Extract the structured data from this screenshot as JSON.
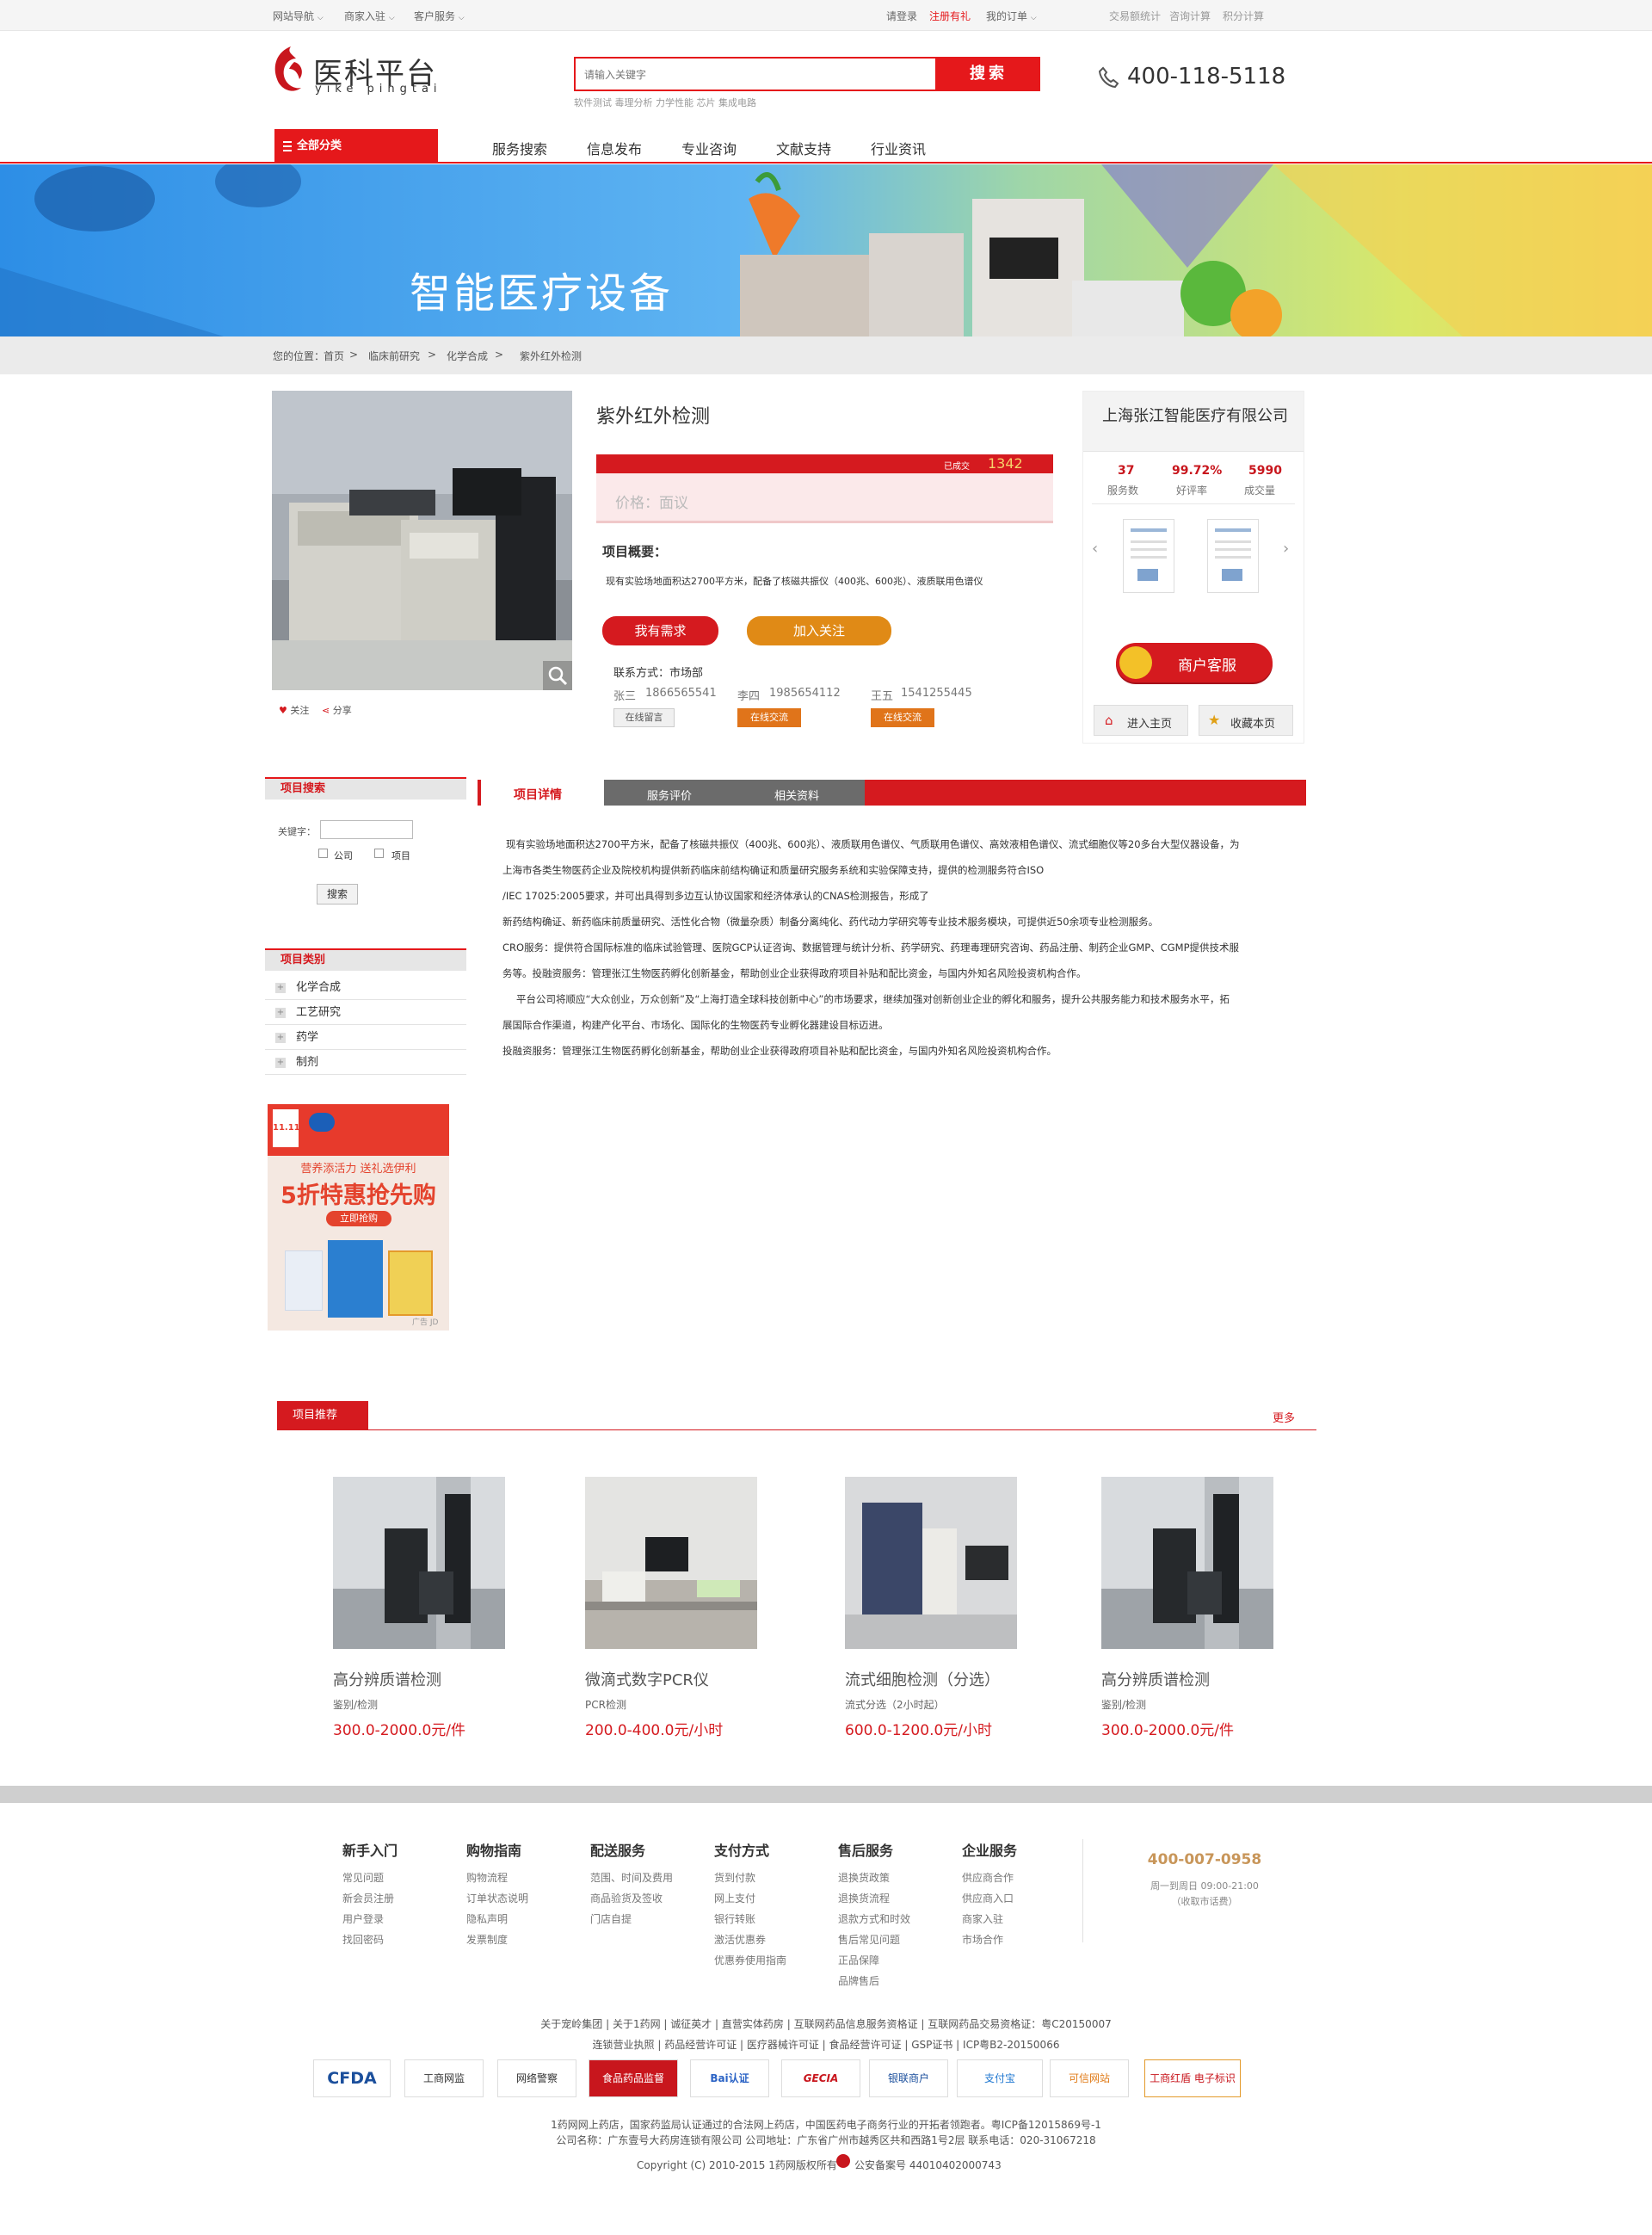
{
  "topbar": {
    "site_nav": "网站导航",
    "merchant_join": "商家入驻",
    "customer_service": "客户服务",
    "login": "请登录",
    "register": "注册有礼",
    "my_orders": "我的订单",
    "trade_stats": "交易额统计",
    "consult_count": "咨询计算",
    "points_count": "积分计算"
  },
  "header": {
    "logo_title": "医科平台",
    "logo_sub": "yike pingtai",
    "search_placeholder": "请输入关键字",
    "search_button": "搜索",
    "hot_words": "软件测试 毒理分析 力学性能 芯片 集成电路",
    "phone": "400-118-5118"
  },
  "nav": {
    "all_categories": "全部分类",
    "items": [
      "服务搜索",
      "信息发布",
      "专业咨询",
      "文献支持",
      "行业资讯"
    ]
  },
  "banner": {
    "title": "智能医疗设备"
  },
  "breadcrumb": {
    "prefix": "您的位置：",
    "items": [
      "首页",
      "临床前研究",
      "化学合成",
      "紫外红外检测"
    ],
    "sep": ">"
  },
  "product": {
    "title": "紫外红外检测",
    "sold_label": "已成交",
    "sold_count": "1342",
    "price_label": "价格：面议",
    "overview_label": "项目概要：",
    "overview_text": "现有实验场地面积达2700平方米，配备了核磁共振仪（400兆、600兆）、液质联用色谱仪",
    "btn_demand": "我有需求",
    "btn_follow": "加入关注",
    "contact_label": "联系方式：市场部",
    "contacts": [
      {
        "name": "张三",
        "phone": "1866565541",
        "button": "在线留言"
      },
      {
        "name": "李四",
        "phone": "1985654112",
        "button": "在线交流"
      },
      {
        "name": "王五",
        "phone": "1541255445",
        "button": "在线交流"
      }
    ],
    "follow_text": "关注",
    "share_text": "分享"
  },
  "company": {
    "name": "上海张江智能医疗有限公司",
    "stats": [
      {
        "value": "37",
        "label": "服务数"
      },
      {
        "value": "99.72%",
        "label": "好评率"
      },
      {
        "value": "5990",
        "label": "成交量"
      }
    ],
    "service_btn": "商户客服",
    "home_btn": "进入主页",
    "fav_btn": "收藏本页"
  },
  "sidebar": {
    "search_title": "项目搜索",
    "keyword_label": "关键字：",
    "opt_company": "公司",
    "opt_project": "项目",
    "search_btn": "搜索",
    "category_title": "项目类别",
    "categories": [
      "化学合成",
      "工艺研究",
      "药学",
      "制剂"
    ]
  },
  "ad": {
    "badge": "11.11",
    "line1": "营养添活力 送礼选伊利",
    "line2": "5折特惠抢先购",
    "btn": "立即抢购",
    "tag": "广告 JD"
  },
  "tabs": {
    "items": [
      "项目详情",
      "服务评价",
      "相关资料"
    ]
  },
  "detail": {
    "lines": [
      "现有实验场地面积达2700平方米，配备了核磁共振仪（400兆、600兆）、液质联用色谱仪、气质联用色谱仪、高效液相色谱仪、流式细胞仪等20多台大型仪器设备，为",
      "上海市各类生物医药企业及院校机构提供新药临床前结构确证和质量研究服务系统和实验保障支持，提供的检测服务符合ISO",
      "/IEC 17025:2005要求，并可出具得到多边互认协议国家和经济体承认的CNAS检测报告，形成了",
      "新药结构确证、新药临床前质量研究、活性化合物（微量杂质）制备分离纯化、药代动力学研究等专业技术服务模块，可提供近50余项专业检测服务。",
      "CRO服务：提供符合国际标准的临床试验管理、医院GCP认证咨询、数据管理与统计分析、药学研究、药理毒理研究咨询、药品注册、制药企业GMP、CGMP提供技术服",
      "务等。投融资服务：管理张江生物医药孵化创新基金，帮助创业企业获得政府项目补贴和配比资金，与国内外知名风险投资机构合作。",
      "平台公司将顺应“大众创业，万众创新”及“上海打造全球科技创新中心”的市场要求，继续加强对创新创业企业的孵化和服务，提升公共服务能力和技术服务水平，拓",
      "展国际合作渠道，构建产化平台、市场化、国际化的生物医药专业孵化器建设目标迈进。",
      "投融资服务：管理张江生物医药孵化创新基金，帮助创业企业获得政府项目补贴和配比资金，与国内外知名风险投资机构合作。"
    ]
  },
  "recommend": {
    "title": "项目推荐",
    "more": "更多",
    "items": [
      {
        "name": "高分辨质谱检测",
        "sub": "鉴别/检测",
        "price": "300.0-2000.0元/件"
      },
      {
        "name": "微滴式数字PCR仪",
        "sub": "PCR检测",
        "price": "200.0-400.0元/小时"
      },
      {
        "name": "流式细胞检测（分选）",
        "sub": "流式分选（2小时起）",
        "price": "600.0-1200.0元/小时"
      },
      {
        "name": "高分辨质谱检测",
        "sub": "鉴别/检测",
        "price": "300.0-2000.0元/件"
      }
    ]
  },
  "footer": {
    "columns": [
      {
        "title": "新手入门",
        "items": [
          "常见问题",
          "新会员注册",
          "用户登录",
          "找回密码"
        ]
      },
      {
        "title": "购物指南",
        "items": [
          "购物流程",
          "订单状态说明",
          "隐私声明",
          "发票制度"
        ]
      },
      {
        "title": "配送服务",
        "items": [
          "范围、时间及费用",
          "商品验货及签收",
          "门店自提"
        ]
      },
      {
        "title": "支付方式",
        "items": [
          "货到付款",
          "网上支付",
          "银行转账",
          "激活优惠券",
          "优惠券使用指南"
        ]
      },
      {
        "title": "售后服务",
        "items": [
          "退换货政策",
          "退换货流程",
          "退款方式和时效",
          "售后常见问题",
          "正品保障",
          "品牌售后"
        ]
      },
      {
        "title": "企业服务",
        "items": [
          "供应商合作",
          "供应商入口",
          "商家入驻",
          "市场合作"
        ]
      }
    ],
    "hotline": "400-007-0958",
    "hours": "周一到周日 09:00-21:00",
    "hours_note": "（收取市话费）",
    "links1": "关于宠岭集团 | 关于1药网 | 诚征英才 | 直营实体药房 | 互联网药品信息服务资格证 | 互联网药品交易资格证：粤C20150007",
    "links1_highlight": "诚征英才",
    "links2": "连锁营业执照 | 药品经营许可证 | 医疗器械许可证 | 食品经营许可证 | GSP证书 | ICP粤B2-20150066",
    "certs": [
      "CFDA",
      "工商网监",
      "网络警察",
      "食品药品监督",
      "Bai认证",
      "GECIA",
      "银联商户",
      "支付宝",
      "可信网站",
      "工商红盾 电子标识"
    ],
    "line1": "1药网网上药店，国家药监局认证通过的合法网上药店，中国医药电子商务行业的开拓者领跑者。粤ICP备12015869号-1",
    "line2": "公司名称：广东壹号大药房连锁有限公司 公司地址：广东省广州市越秀区共和西路1号2层 联系电话：020-31067218",
    "line3": "Copyright (C) 2010-2015 1药网版权所有",
    "beian": "公安备案号 44010402000743"
  },
  "colors": {
    "brand_red": "#e5181b",
    "accent_orange": "#e08a16",
    "price_red": "#d51a1f"
  }
}
